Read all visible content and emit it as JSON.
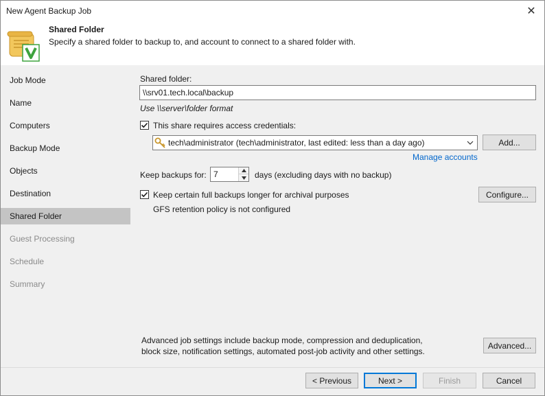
{
  "window": {
    "title": "New Agent Backup Job",
    "close_glyph": "✕"
  },
  "header": {
    "title": "Shared Folder",
    "description": "Specify a shared folder to backup to, and account to connect to a shared folder with.",
    "icon": "scroll-check-icon"
  },
  "nav": {
    "items": [
      {
        "label": "Job Mode",
        "state": "normal"
      },
      {
        "label": "Name",
        "state": "normal"
      },
      {
        "label": "Computers",
        "state": "normal"
      },
      {
        "label": "Backup Mode",
        "state": "normal"
      },
      {
        "label": "Objects",
        "state": "normal"
      },
      {
        "label": "Destination",
        "state": "normal"
      },
      {
        "label": "Shared Folder",
        "state": "active"
      },
      {
        "label": "Guest Processing",
        "state": "disabled"
      },
      {
        "label": "Schedule",
        "state": "disabled"
      },
      {
        "label": "Summary",
        "state": "disabled"
      }
    ]
  },
  "form": {
    "shared_folder_label": "Shared folder:",
    "shared_folder_value": "\\\\srv01.tech.local\\backup",
    "format_hint": "Use \\\\server\\folder format",
    "credentials_checkbox_label": "This share requires access credentials:",
    "credentials_checked": true,
    "credentials_value": "tech\\administrator (tech\\administrator, last edited: less than a day ago)",
    "add_button": "Add...",
    "manage_accounts_link": "Manage accounts",
    "keep_backups_label": "Keep backups for:",
    "keep_backups_value": "7",
    "keep_backups_suffix": "days (excluding days with no backup)",
    "gfs_checkbox_label": "Keep certain full backups longer for archival purposes",
    "gfs_checked": true,
    "configure_button": "Configure...",
    "gfs_status": "GFS retention policy is not configured",
    "advanced_text_line1": "Advanced job settings include backup mode, compression and deduplication,",
    "advanced_text_line2": "block size, notification settings, automated post-job activity and other settings.",
    "advanced_button": "Advanced..."
  },
  "footer": {
    "previous": "< Previous",
    "next": "Next >",
    "finish": "Finish",
    "cancel": "Cancel"
  },
  "colors": {
    "accent": "#0078d7",
    "link": "#0066cc",
    "panel": "#f0f0f0",
    "nav_active": "#c4c4c4",
    "icon_scroll": "#f2c75c",
    "icon_check": "#3ea33e"
  }
}
